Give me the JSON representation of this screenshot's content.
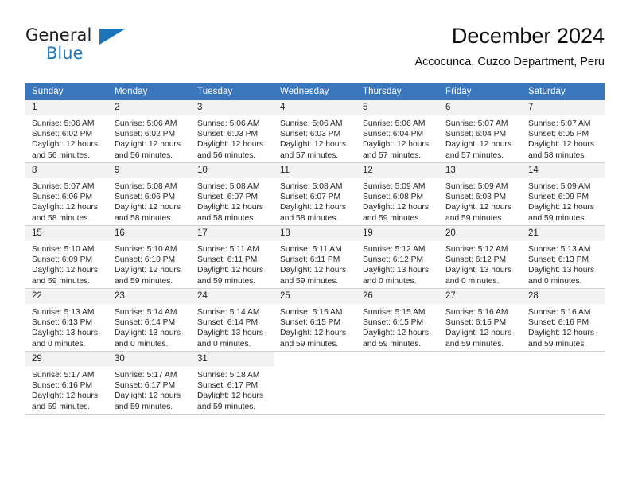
{
  "brand": {
    "name_top": "General",
    "name_bottom": "Blue",
    "triangle_color": "#1b75bb",
    "text_color": "#1b1b1b"
  },
  "header": {
    "title": "December 2024",
    "subtitle": "Accocunca, Cuzco Department, Peru"
  },
  "colors": {
    "header_row_bg": "#3a76bb",
    "header_row_text": "#ffffff",
    "daynum_bg": "#f2f2f2",
    "grid_line": "#d0d0d0",
    "accent_blue": "#1b75bb"
  },
  "weekday_headers": [
    "Sunday",
    "Monday",
    "Tuesday",
    "Wednesday",
    "Thursday",
    "Friday",
    "Saturday"
  ],
  "weeks": [
    [
      {
        "day": "1",
        "sunrise": "Sunrise: 5:06 AM",
        "sunset": "Sunset: 6:02 PM",
        "daylight1": "Daylight: 12 hours",
        "daylight2": "and 56 minutes."
      },
      {
        "day": "2",
        "sunrise": "Sunrise: 5:06 AM",
        "sunset": "Sunset: 6:02 PM",
        "daylight1": "Daylight: 12 hours",
        "daylight2": "and 56 minutes."
      },
      {
        "day": "3",
        "sunrise": "Sunrise: 5:06 AM",
        "sunset": "Sunset: 6:03 PM",
        "daylight1": "Daylight: 12 hours",
        "daylight2": "and 56 minutes."
      },
      {
        "day": "4",
        "sunrise": "Sunrise: 5:06 AM",
        "sunset": "Sunset: 6:03 PM",
        "daylight1": "Daylight: 12 hours",
        "daylight2": "and 57 minutes."
      },
      {
        "day": "5",
        "sunrise": "Sunrise: 5:06 AM",
        "sunset": "Sunset: 6:04 PM",
        "daylight1": "Daylight: 12 hours",
        "daylight2": "and 57 minutes."
      },
      {
        "day": "6",
        "sunrise": "Sunrise: 5:07 AM",
        "sunset": "Sunset: 6:04 PM",
        "daylight1": "Daylight: 12 hours",
        "daylight2": "and 57 minutes."
      },
      {
        "day": "7",
        "sunrise": "Sunrise: 5:07 AM",
        "sunset": "Sunset: 6:05 PM",
        "daylight1": "Daylight: 12 hours",
        "daylight2": "and 58 minutes."
      }
    ],
    [
      {
        "day": "8",
        "sunrise": "Sunrise: 5:07 AM",
        "sunset": "Sunset: 6:06 PM",
        "daylight1": "Daylight: 12 hours",
        "daylight2": "and 58 minutes."
      },
      {
        "day": "9",
        "sunrise": "Sunrise: 5:08 AM",
        "sunset": "Sunset: 6:06 PM",
        "daylight1": "Daylight: 12 hours",
        "daylight2": "and 58 minutes."
      },
      {
        "day": "10",
        "sunrise": "Sunrise: 5:08 AM",
        "sunset": "Sunset: 6:07 PM",
        "daylight1": "Daylight: 12 hours",
        "daylight2": "and 58 minutes."
      },
      {
        "day": "11",
        "sunrise": "Sunrise: 5:08 AM",
        "sunset": "Sunset: 6:07 PM",
        "daylight1": "Daylight: 12 hours",
        "daylight2": "and 58 minutes."
      },
      {
        "day": "12",
        "sunrise": "Sunrise: 5:09 AM",
        "sunset": "Sunset: 6:08 PM",
        "daylight1": "Daylight: 12 hours",
        "daylight2": "and 59 minutes."
      },
      {
        "day": "13",
        "sunrise": "Sunrise: 5:09 AM",
        "sunset": "Sunset: 6:08 PM",
        "daylight1": "Daylight: 12 hours",
        "daylight2": "and 59 minutes."
      },
      {
        "day": "14",
        "sunrise": "Sunrise: 5:09 AM",
        "sunset": "Sunset: 6:09 PM",
        "daylight1": "Daylight: 12 hours",
        "daylight2": "and 59 minutes."
      }
    ],
    [
      {
        "day": "15",
        "sunrise": "Sunrise: 5:10 AM",
        "sunset": "Sunset: 6:09 PM",
        "daylight1": "Daylight: 12 hours",
        "daylight2": "and 59 minutes."
      },
      {
        "day": "16",
        "sunrise": "Sunrise: 5:10 AM",
        "sunset": "Sunset: 6:10 PM",
        "daylight1": "Daylight: 12 hours",
        "daylight2": "and 59 minutes."
      },
      {
        "day": "17",
        "sunrise": "Sunrise: 5:11 AM",
        "sunset": "Sunset: 6:11 PM",
        "daylight1": "Daylight: 12 hours",
        "daylight2": "and 59 minutes."
      },
      {
        "day": "18",
        "sunrise": "Sunrise: 5:11 AM",
        "sunset": "Sunset: 6:11 PM",
        "daylight1": "Daylight: 12 hours",
        "daylight2": "and 59 minutes."
      },
      {
        "day": "19",
        "sunrise": "Sunrise: 5:12 AM",
        "sunset": "Sunset: 6:12 PM",
        "daylight1": "Daylight: 13 hours",
        "daylight2": "and 0 minutes."
      },
      {
        "day": "20",
        "sunrise": "Sunrise: 5:12 AM",
        "sunset": "Sunset: 6:12 PM",
        "daylight1": "Daylight: 13 hours",
        "daylight2": "and 0 minutes."
      },
      {
        "day": "21",
        "sunrise": "Sunrise: 5:13 AM",
        "sunset": "Sunset: 6:13 PM",
        "daylight1": "Daylight: 13 hours",
        "daylight2": "and 0 minutes."
      }
    ],
    [
      {
        "day": "22",
        "sunrise": "Sunrise: 5:13 AM",
        "sunset": "Sunset: 6:13 PM",
        "daylight1": "Daylight: 13 hours",
        "daylight2": "and 0 minutes."
      },
      {
        "day": "23",
        "sunrise": "Sunrise: 5:14 AM",
        "sunset": "Sunset: 6:14 PM",
        "daylight1": "Daylight: 13 hours",
        "daylight2": "and 0 minutes."
      },
      {
        "day": "24",
        "sunrise": "Sunrise: 5:14 AM",
        "sunset": "Sunset: 6:14 PM",
        "daylight1": "Daylight: 13 hours",
        "daylight2": "and 0 minutes."
      },
      {
        "day": "25",
        "sunrise": "Sunrise: 5:15 AM",
        "sunset": "Sunset: 6:15 PM",
        "daylight1": "Daylight: 12 hours",
        "daylight2": "and 59 minutes."
      },
      {
        "day": "26",
        "sunrise": "Sunrise: 5:15 AM",
        "sunset": "Sunset: 6:15 PM",
        "daylight1": "Daylight: 12 hours",
        "daylight2": "and 59 minutes."
      },
      {
        "day": "27",
        "sunrise": "Sunrise: 5:16 AM",
        "sunset": "Sunset: 6:15 PM",
        "daylight1": "Daylight: 12 hours",
        "daylight2": "and 59 minutes."
      },
      {
        "day": "28",
        "sunrise": "Sunrise: 5:16 AM",
        "sunset": "Sunset: 6:16 PM",
        "daylight1": "Daylight: 12 hours",
        "daylight2": "and 59 minutes."
      }
    ],
    [
      {
        "day": "29",
        "sunrise": "Sunrise: 5:17 AM",
        "sunset": "Sunset: 6:16 PM",
        "daylight1": "Daylight: 12 hours",
        "daylight2": "and 59 minutes."
      },
      {
        "day": "30",
        "sunrise": "Sunrise: 5:17 AM",
        "sunset": "Sunset: 6:17 PM",
        "daylight1": "Daylight: 12 hours",
        "daylight2": "and 59 minutes."
      },
      {
        "day": "31",
        "sunrise": "Sunrise: 5:18 AM",
        "sunset": "Sunset: 6:17 PM",
        "daylight1": "Daylight: 12 hours",
        "daylight2": "and 59 minutes."
      },
      {
        "day": "",
        "sunrise": "",
        "sunset": "",
        "daylight1": "",
        "daylight2": ""
      },
      {
        "day": "",
        "sunrise": "",
        "sunset": "",
        "daylight1": "",
        "daylight2": ""
      },
      {
        "day": "",
        "sunrise": "",
        "sunset": "",
        "daylight1": "",
        "daylight2": ""
      },
      {
        "day": "",
        "sunrise": "",
        "sunset": "",
        "daylight1": "",
        "daylight2": ""
      }
    ]
  ]
}
